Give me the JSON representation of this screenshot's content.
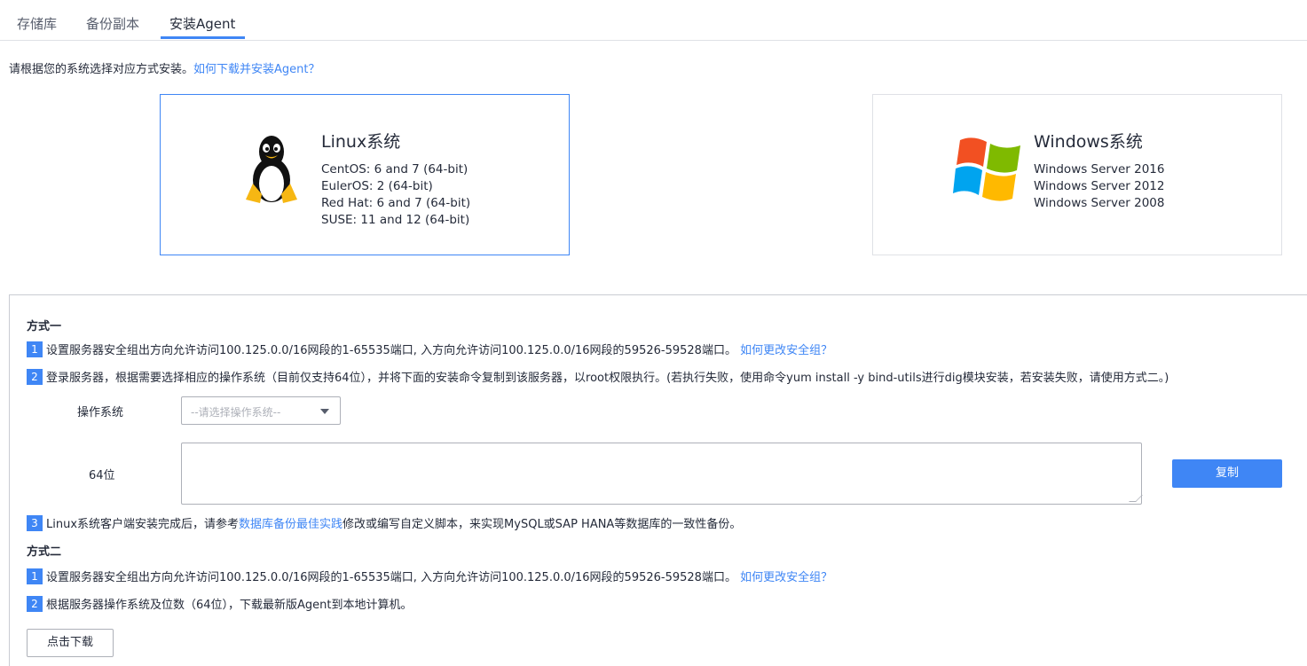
{
  "tabs": [
    {
      "label": "存储库"
    },
    {
      "label": "备份副本"
    },
    {
      "label": "安装Agent"
    }
  ],
  "intro": {
    "text": "请根据您的系统选择对应方式安装。",
    "link": "如何下载并安装Agent？"
  },
  "os_cards": {
    "linux": {
      "title": "Linux系统",
      "versions": [
        "CentOS: 6 and 7 (64-bit)",
        "EulerOS: 2 (64-bit)",
        "Red Hat: 6 and 7 (64-bit)",
        "SUSE: 11 and 12 (64-bit)"
      ],
      "icon": "tux-penguin-icon"
    },
    "windows": {
      "title": "Windows系统",
      "versions": [
        "Windows Server 2016",
        "Windows Server 2012",
        "Windows Server 2008"
      ],
      "icon": "windows-flag-icon"
    }
  },
  "method1": {
    "title": "方式一",
    "steps": [
      {
        "num": "1",
        "text": "设置服务器安全组出方向允许访问100.125.0.0/16网段的1-65535端口, 入方向允许访问100.125.0.0/16网段的59526-59528端口。",
        "link": "如何更改安全组？"
      },
      {
        "num": "2",
        "text": "登录服务器，根据需要选择相应的操作系统（目前仅支持64位），并将下面的安装命令复制到该服务器，以root权限执行。(若执行失败，使用命令yum install -y bind-utils进行dig模块安装，若安装失败，请使用方式二。)"
      },
      {
        "num": "3",
        "text_before": "Linux系统客户端安装完成后，请参考",
        "link": "数据库备份最佳实践",
        "text_after": "修改或编写自定义脚本，来实现MySQL或SAP HANA等数据库的一致性备份。"
      }
    ],
    "os_label": "操作系统",
    "os_placeholder": "--请选择操作系统--",
    "bit_label": "64位",
    "command_value": "",
    "copy_label": "复制"
  },
  "method2": {
    "title": "方式二",
    "steps": [
      {
        "num": "1",
        "text": "设置服务器安全组出方向允许访问100.125.0.0/16网段的1-65535端口, 入方向允许访问100.125.0.0/16网段的59526-59528端口。",
        "link": "如何更改安全组？"
      },
      {
        "num": "2",
        "text": "根据服务器操作系统及位数（64位），下载最新版Agent到本地计算机。"
      }
    ],
    "download_label": "点击下载"
  },
  "colors": {
    "accent": "#3f86f5",
    "text": "#252b3a",
    "border": "#dfe1e6"
  }
}
